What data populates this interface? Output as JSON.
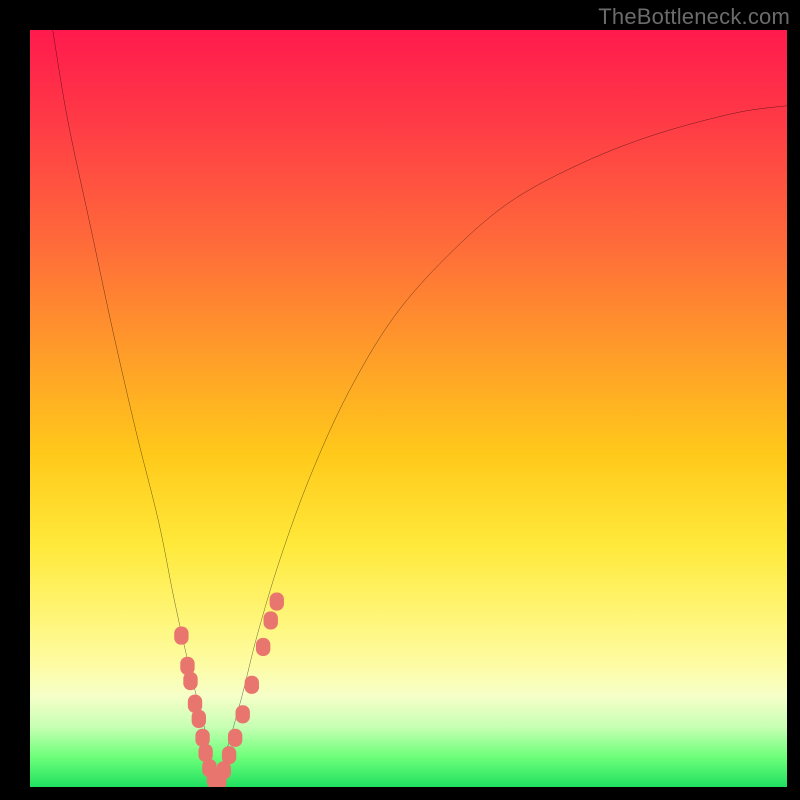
{
  "watermark": "TheBottleneck.com",
  "chart_data": {
    "type": "line",
    "title": "",
    "xlabel": "",
    "ylabel": "",
    "xlim": [
      0,
      100
    ],
    "ylim": [
      0,
      100
    ],
    "grid": false,
    "legend": false,
    "series": [
      {
        "name": "bottleneck-curve",
        "color": "#000000",
        "x": [
          3,
          5,
          8,
          11,
          14,
          17,
          19,
          21,
          23,
          24.5,
          26,
          28,
          30,
          33,
          37,
          42,
          48,
          55,
          63,
          72,
          82,
          93,
          100
        ],
        "y": [
          100,
          88,
          74,
          60,
          47,
          35,
          25,
          16,
          8,
          1,
          5,
          12,
          20,
          30,
          41,
          52,
          62,
          70,
          77,
          82,
          86,
          89,
          90
        ]
      }
    ],
    "markers": [
      {
        "name": "data-points-left",
        "color": "#e8766f",
        "shape": "rounded-square",
        "x": [
          20.0,
          20.8,
          21.2,
          21.8,
          22.3,
          22.8,
          23.2,
          23.7,
          24.3
        ],
        "y": [
          20.0,
          16.0,
          14.0,
          11.0,
          9.0,
          6.5,
          4.5,
          2.5,
          1.0
        ]
      },
      {
        "name": "data-points-right",
        "color": "#e8766f",
        "shape": "rounded-square",
        "x": [
          25.0,
          25.6,
          26.3,
          27.1,
          28.1,
          29.3,
          30.8,
          31.8,
          32.6
        ],
        "y": [
          0.8,
          2.2,
          4.2,
          6.5,
          9.6,
          13.5,
          18.5,
          22.0,
          24.5
        ]
      }
    ],
    "background_gradient": {
      "direction": "top-to-bottom",
      "stops": [
        {
          "pos": 0.0,
          "color": "#ff1a4d"
        },
        {
          "pos": 0.28,
          "color": "#ff6a3a"
        },
        {
          "pos": 0.56,
          "color": "#ffc91a"
        },
        {
          "pos": 0.78,
          "color": "#fff67a"
        },
        {
          "pos": 0.9,
          "color": "#c8ffb4"
        },
        {
          "pos": 1.0,
          "color": "#20e060"
        }
      ]
    }
  }
}
